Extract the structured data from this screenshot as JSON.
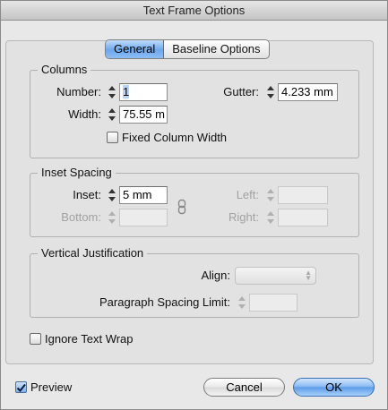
{
  "window": {
    "title": "Text Frame Options"
  },
  "tabs": [
    {
      "label": "General",
      "active": true
    },
    {
      "label": "Baseline Options",
      "active": false
    }
  ],
  "columns": {
    "legend": "Columns",
    "number_label": "Number:",
    "number_value": "1",
    "width_label": "Width:",
    "width_value": "75.55 m",
    "gutter_label": "Gutter:",
    "gutter_value": "4.233 mm",
    "fixed_width_label": "Fixed Column Width",
    "fixed_width_checked": false
  },
  "inset": {
    "legend": "Inset Spacing",
    "inset_label": "Inset:",
    "inset_value": "5 mm",
    "bottom_label": "Bottom:",
    "left_label": "Left:",
    "right_label": "Right:",
    "link_icon": "chain-link-icon"
  },
  "vertical": {
    "legend": "Vertical Justification",
    "align_label": "Align:",
    "paragraph_limit_label": "Paragraph Spacing Limit:"
  },
  "ignore_text_wrap": {
    "label": "Ignore Text Wrap",
    "checked": false
  },
  "footer": {
    "preview_label": "Preview",
    "preview_checked": true,
    "cancel_label": "Cancel",
    "ok_label": "OK"
  },
  "colors": {
    "accent": "#6aa8ee",
    "primary_button": "#5d9ce8"
  }
}
